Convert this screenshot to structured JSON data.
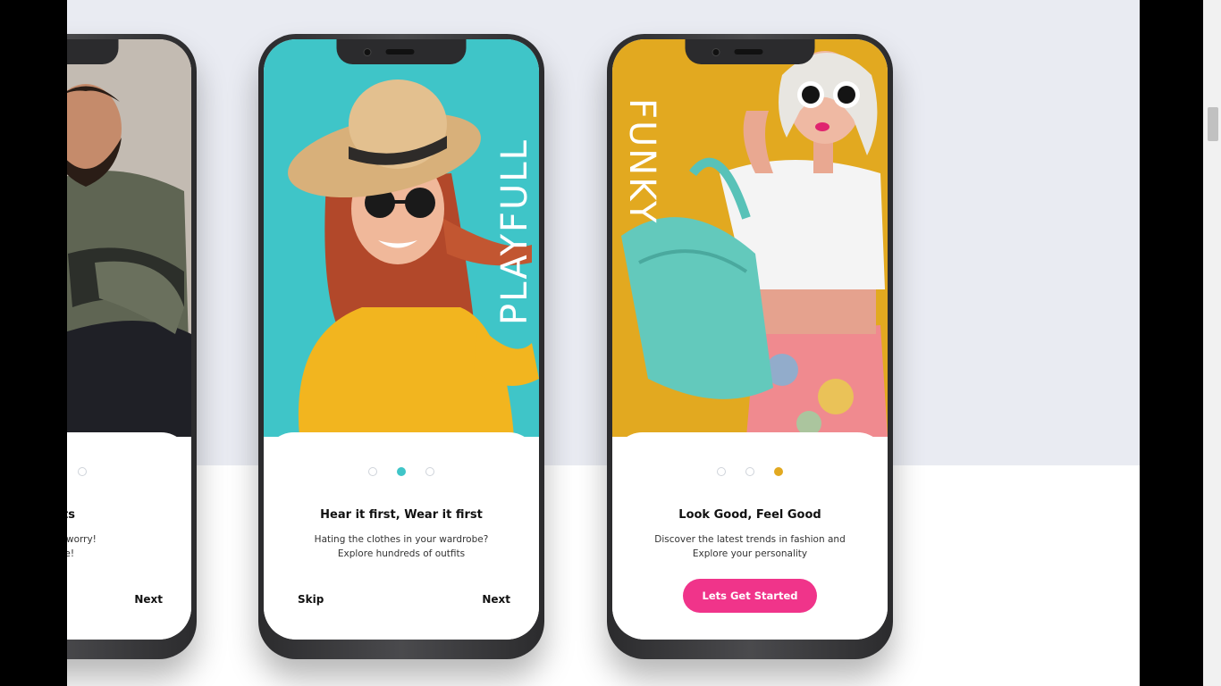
{
  "colors": {
    "accent_teal": "#3fc5c8",
    "accent_yellow": "#e2a920",
    "cta_pink": "#f0348a"
  },
  "phones": [
    {
      "title": "outfits",
      "desc_line1": "utfit? Don't worry!",
      "desc_line2": "tfit here!",
      "next_label": "Next",
      "active_dot": 1
    },
    {
      "vertical_word": "PLAYFULL",
      "title": "Hear it first, Wear it first",
      "desc_line1": "Hating the clothes in your wardrobe?",
      "desc_line2": "Explore hundreds of outfits",
      "skip_label": "Skip",
      "next_label": "Next",
      "active_dot": 2
    },
    {
      "vertical_word": "FUNKY",
      "title": "Look Good, Feel Good",
      "desc_line1": "Discover the latest trends in fashion and",
      "desc_line2": "Explore your personality",
      "cta_label": "Lets Get Started",
      "active_dot": 3
    }
  ]
}
